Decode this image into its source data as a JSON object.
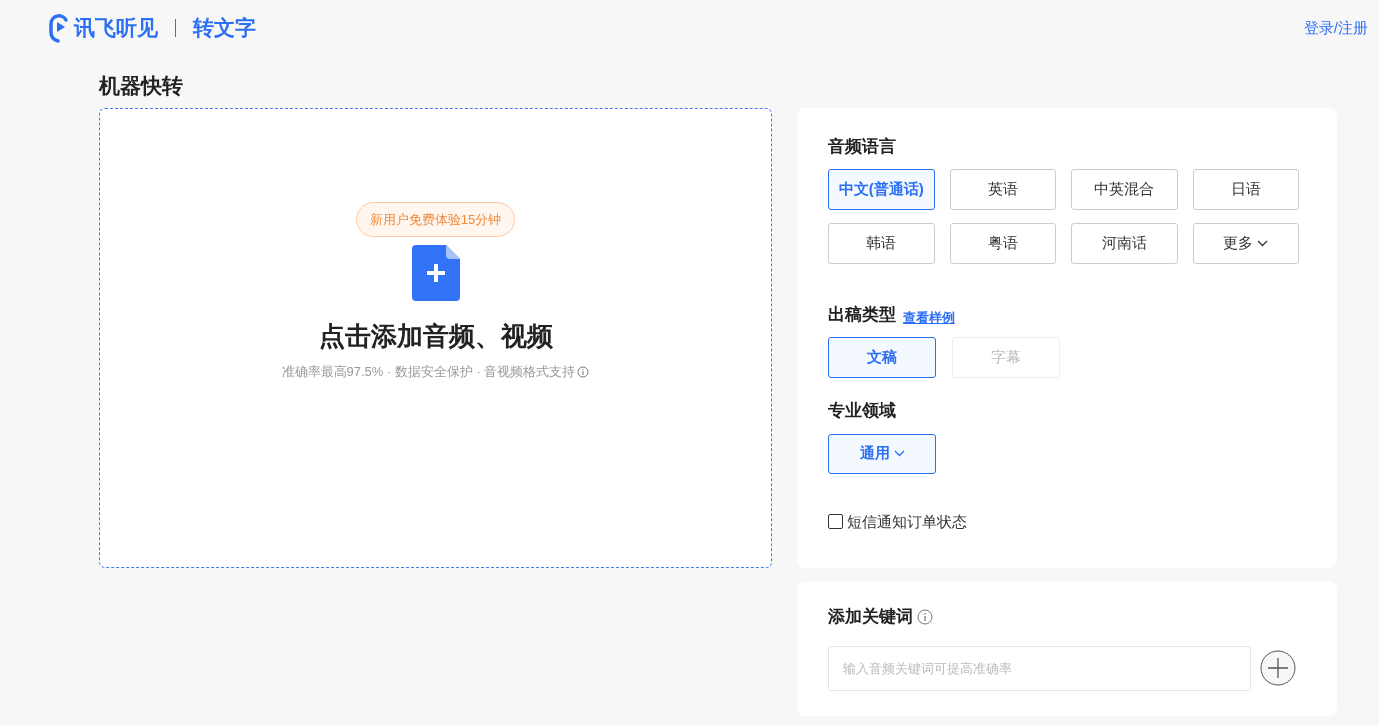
{
  "header": {
    "brand": "讯飞听见",
    "product": "转文字",
    "login": "登录/注册"
  },
  "page_title": "机器快转",
  "upload": {
    "badge": "新用户免费体验15分钟",
    "title": "点击添加音频、视频",
    "subtitle": "准确率最高97.5% · 数据安全保护 · 音视频格式支持"
  },
  "language": {
    "label": "音频语言",
    "options": [
      {
        "label": "中文(普通话)",
        "selected": true,
        "kind": "option"
      },
      {
        "label": "英语",
        "selected": false,
        "kind": "option"
      },
      {
        "label": "中英混合",
        "selected": false,
        "kind": "option"
      },
      {
        "label": "日语",
        "selected": false,
        "kind": "option"
      },
      {
        "label": "韩语",
        "selected": false,
        "kind": "option"
      },
      {
        "label": "粤语",
        "selected": false,
        "kind": "option"
      },
      {
        "label": "河南话",
        "selected": false,
        "kind": "option"
      },
      {
        "label": "更多",
        "selected": false,
        "kind": "dropdown"
      }
    ]
  },
  "output_type": {
    "label": "出稿类型",
    "link": "查看样例",
    "options": [
      {
        "label": "文稿",
        "selected": true,
        "disabled": false
      },
      {
        "label": "字幕",
        "selected": false,
        "disabled": true
      }
    ]
  },
  "domain": {
    "label": "专业领域",
    "value": "通用"
  },
  "sms_notify": {
    "label": "短信通知订单状态",
    "checked": false
  },
  "keywords": {
    "label": "添加关键词",
    "placeholder": "输入音频关键词可提高准确率"
  }
}
